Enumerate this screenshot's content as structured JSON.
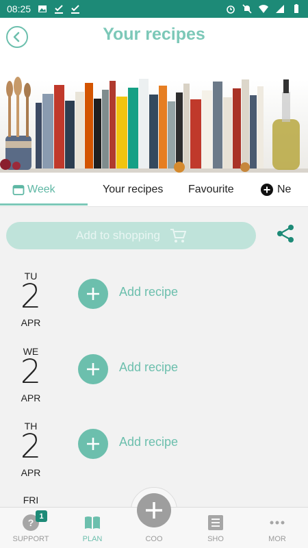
{
  "status_bar": {
    "time": "08:25"
  },
  "header": {
    "title": "Your recipes",
    "back_icon": "back-arrow-icon"
  },
  "tabs": [
    {
      "label": "Week",
      "active": true
    },
    {
      "label": "Your recipes",
      "active": false
    },
    {
      "label": "Favourite",
      "active": false
    },
    {
      "label": "Ne",
      "active": false
    }
  ],
  "shopping": {
    "label": "Add to shopping"
  },
  "days": [
    {
      "abbr": "TU",
      "num": "2",
      "month": "APR",
      "action": "Add recipe"
    },
    {
      "abbr": "WE",
      "num": "2",
      "month": "APR",
      "action": "Add recipe"
    },
    {
      "abbr": "TH",
      "num": "2",
      "month": "APR",
      "action": "Add recipe"
    },
    {
      "abbr": "FRI",
      "num": "",
      "month": "",
      "action": ""
    }
  ],
  "bottom_nav": [
    {
      "label": "SUPPORT",
      "badge": "1",
      "active": false
    },
    {
      "label": "PLAN",
      "active": true
    },
    {
      "label": "COO",
      "active": false
    },
    {
      "label": "SHO",
      "active": false
    },
    {
      "label": "MOR",
      "active": false
    }
  ],
  "colors": {
    "accent": "#6cbfad",
    "title": "#7cc8b8",
    "status_bar": "#1d8a77",
    "shopping_bg": "#bfe3da"
  }
}
